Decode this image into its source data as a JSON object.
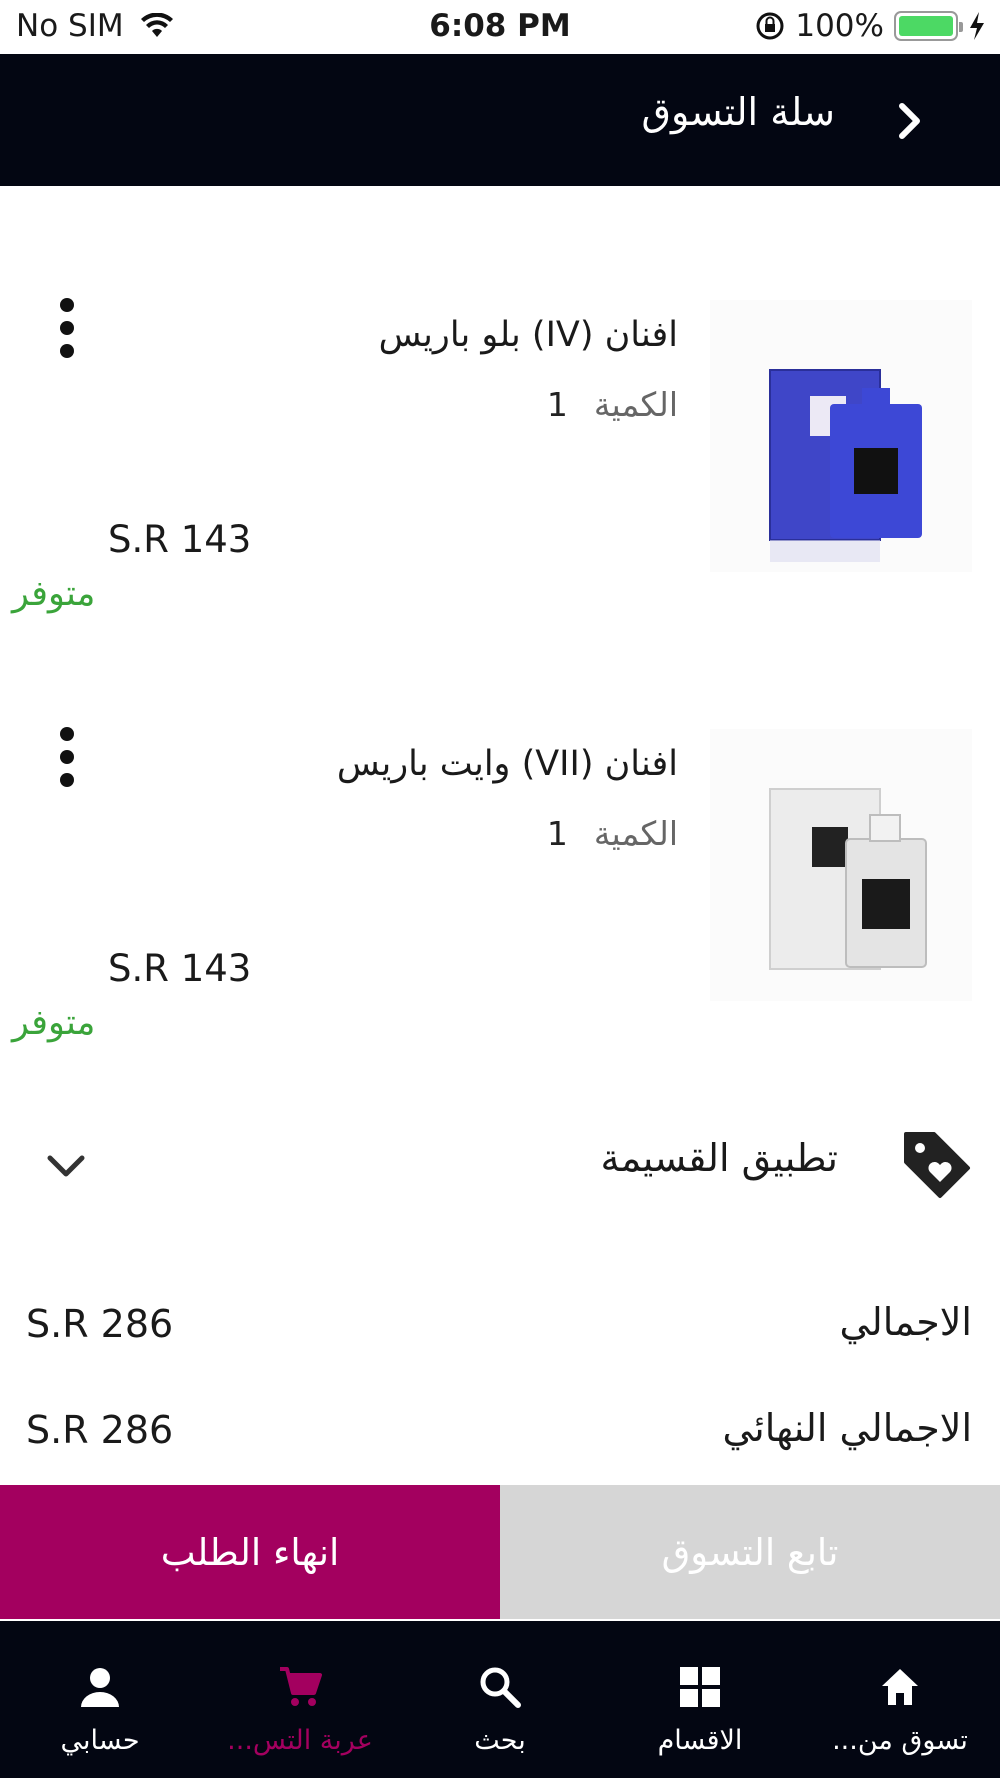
{
  "status_bar": {
    "carrier": "No SIM",
    "time": "6:08 PM",
    "battery": "100%"
  },
  "header": {
    "title": "سلة التسوق"
  },
  "cart_items": [
    {
      "name": "افنان (IV) بلو باريس",
      "qty_label": "الكمية",
      "qty": "1",
      "price": "S.R 143",
      "stock": "متوفر"
    },
    {
      "name": "افنان (VII) وايت باريس",
      "qty_label": "الكمية",
      "qty": "1",
      "price": "S.R 143",
      "stock": "متوفر"
    }
  ],
  "coupon": {
    "label": "تطبيق القسيمة"
  },
  "totals": {
    "subtotal_label": "الاجمالي",
    "subtotal_value": "S.R 286",
    "final_label": "الاجمالي النهائي",
    "final_value": "S.R 286"
  },
  "actions": {
    "continue_label": "تابع التسوق",
    "checkout_label": "انهاء الطلب"
  },
  "tabs": [
    {
      "label": "تسوق من...",
      "icon": "home-icon"
    },
    {
      "label": "الاقسام",
      "icon": "grid-icon"
    },
    {
      "label": "بحث",
      "icon": "search-icon"
    },
    {
      "label": "عربة التس...",
      "icon": "cart-icon",
      "active": true
    },
    {
      "label": "حسابي",
      "icon": "person-icon"
    }
  ],
  "colors": {
    "accent": "#a3005f",
    "nav_bg": "#030612",
    "in_stock": "#3aa43a",
    "secondary_button": "#d6d6d6"
  }
}
